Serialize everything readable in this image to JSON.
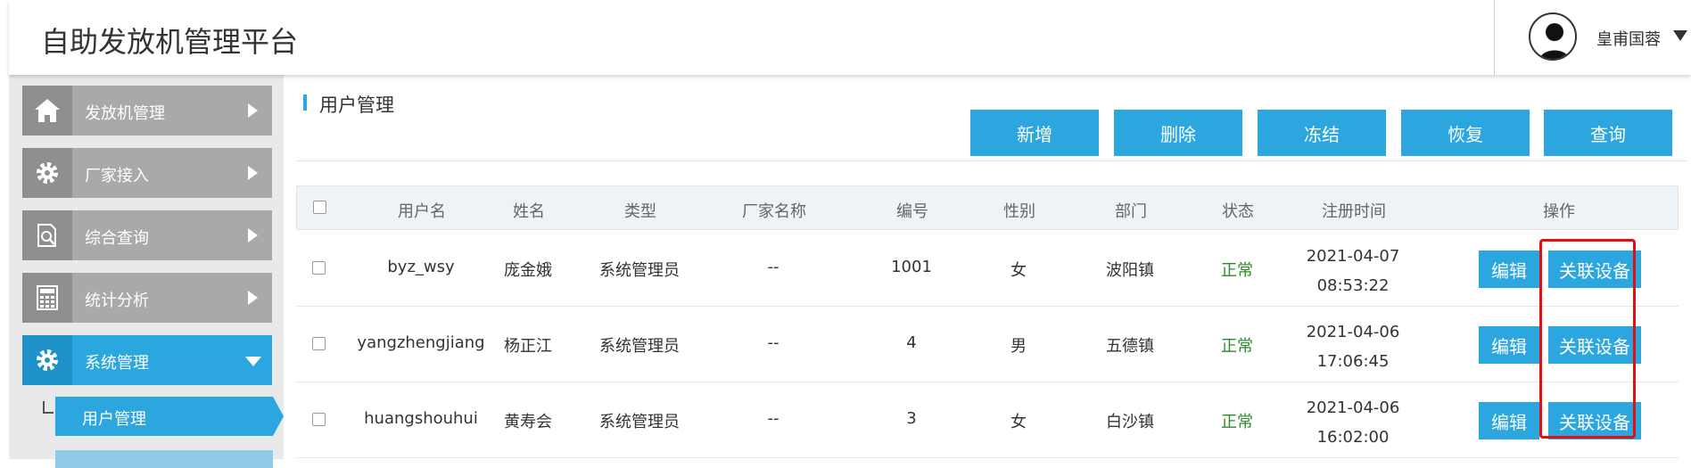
{
  "header": {
    "title": "自助发放机管理平台",
    "user_name": "皇甫国蓉"
  },
  "sidebar": {
    "items": [
      {
        "label": "发放机管理",
        "icon": "home-icon"
      },
      {
        "label": "厂家接入",
        "icon": "gear-icon"
      },
      {
        "label": "综合查询",
        "icon": "document-search-icon"
      },
      {
        "label": "统计分析",
        "icon": "calculator-icon"
      },
      {
        "label": "系统管理",
        "icon": "gear-icon"
      }
    ],
    "sub_items": [
      {
        "label": "用户管理"
      }
    ]
  },
  "main": {
    "section_title": "用户管理",
    "toolbar": {
      "add": "新增",
      "delete": "删除",
      "freeze": "冻结",
      "restore": "恢复",
      "query": "查询"
    },
    "table": {
      "columns": [
        "用户名",
        "姓名",
        "类型",
        "厂家名称",
        "编号",
        "性别",
        "部门",
        "状态",
        "注册时间",
        "操作"
      ],
      "rows": [
        {
          "username": "byz_wsy",
          "name": "庞金娥",
          "type": "系统管理员",
          "vendor": "--",
          "number": "1001",
          "gender": "女",
          "dept": "波阳镇",
          "status": "正常",
          "date": "2021-04-07",
          "time": "08:53:22",
          "edit": "编辑",
          "link": "关联设备"
        },
        {
          "username": "yangzhengjiang",
          "name": "杨正江",
          "type": "系统管理员",
          "vendor": "--",
          "number": "4",
          "gender": "男",
          "dept": "五德镇",
          "status": "正常",
          "date": "2021-04-06",
          "time": "17:06:45",
          "edit": "编辑",
          "link": "关联设备"
        },
        {
          "username": "huangshouhui",
          "name": "黄寿会",
          "type": "系统管理员",
          "vendor": "--",
          "number": "3",
          "gender": "女",
          "dept": "白沙镇",
          "status": "正常",
          "date": "2021-04-06",
          "time": "16:02:00",
          "edit": "编辑",
          "link": "关联设备"
        }
      ]
    }
  },
  "colors": {
    "accent": "#2ba6df",
    "sidebar_item": "#a9a9a9",
    "status_ok": "#2c8a2c",
    "highlight": "#e01010"
  }
}
